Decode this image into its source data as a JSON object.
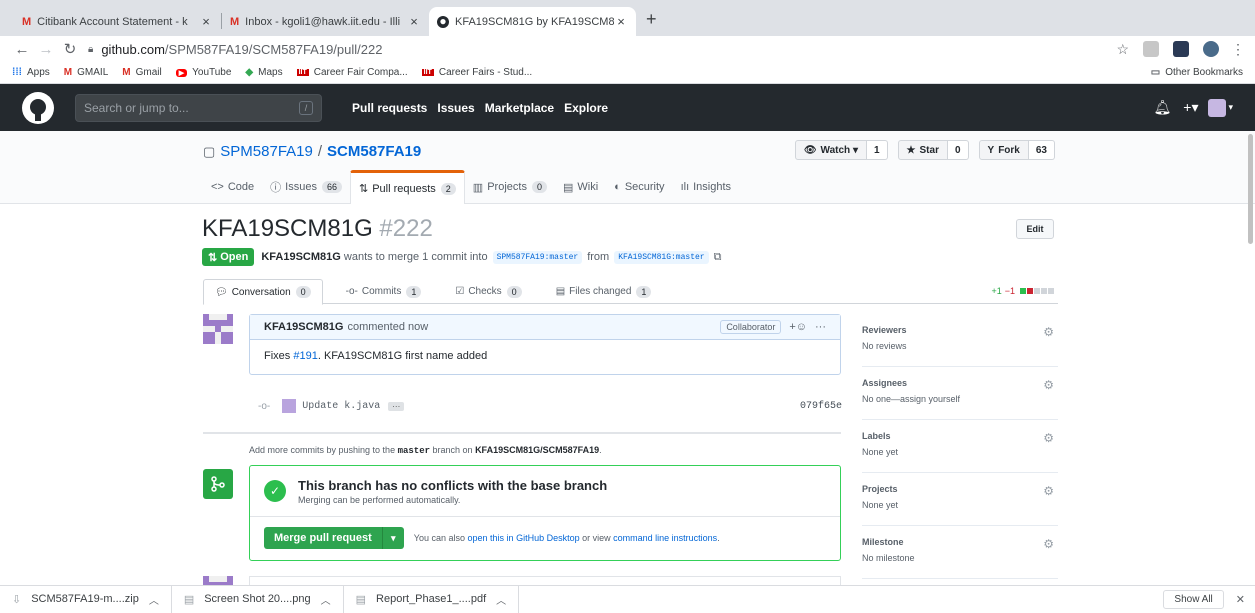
{
  "browser": {
    "tabs": [
      {
        "title": "Citibank Account Statement - k"
      },
      {
        "title": "Inbox - kgoli1@hawk.iit.edu - Illi"
      },
      {
        "title": "KFA19SCM81G by KFA19SCM81"
      }
    ],
    "url_host": "github.com",
    "url_path": "/SPM587FA19/SCM587FA19/pull/222",
    "bookmarks": [
      {
        "label": "Apps",
        "icon": "apps-grid-icon"
      },
      {
        "label": "GMAIL",
        "icon": "gmail-icon"
      },
      {
        "label": "Gmail",
        "icon": "gmail-icon"
      },
      {
        "label": "YouTube",
        "icon": "youtube-icon"
      },
      {
        "label": "Maps",
        "icon": "maps-icon"
      },
      {
        "label": "Career Fair Compa...",
        "icon": "iit-icon"
      },
      {
        "label": "Career Fairs - Stud...",
        "icon": "iit-icon"
      }
    ],
    "other_bookmarks": "Other Bookmarks"
  },
  "github": {
    "search_placeholder": "Search or jump to...",
    "search_key": "/",
    "nav": [
      "Pull requests",
      "Issues",
      "Marketplace",
      "Explore"
    ]
  },
  "repo": {
    "owner": "SPM587FA19",
    "sep": "/",
    "name": "SCM587FA19",
    "watch_label": "Watch",
    "watch_count": "1",
    "star_label": "Star",
    "star_count": "0",
    "fork_label": "Fork",
    "fork_count": "63",
    "tabs": [
      {
        "label": "Code",
        "count": ""
      },
      {
        "label": "Issues",
        "count": "66"
      },
      {
        "label": "Pull requests",
        "count": "2"
      },
      {
        "label": "Projects",
        "count": "0"
      },
      {
        "label": "Wiki",
        "count": ""
      },
      {
        "label": "Security",
        "count": ""
      },
      {
        "label": "Insights",
        "count": ""
      }
    ]
  },
  "pr": {
    "title": "KFA19SCM81G",
    "number": "#222",
    "edit_label": "Edit",
    "status": "Open",
    "author": "KFA19SCM81G",
    "meta_text": "wants to merge 1 commit into",
    "base_branch": "SPM587FA19:master",
    "from_text": "from",
    "head_branch": "KFA19SCM81G:master",
    "tabs": [
      {
        "label": "Conversation",
        "count": "0"
      },
      {
        "label": "Commits",
        "count": "1"
      },
      {
        "label": "Checks",
        "count": "0"
      },
      {
        "label": "Files changed",
        "count": "1"
      }
    ],
    "diff_plus": "+1",
    "diff_minus": "−1"
  },
  "comment": {
    "author": "KFA19SCM81G",
    "action": "commented now",
    "role": "Collaborator",
    "body_prefix": "Fixes",
    "issue_link": "#191",
    "body_rest": ". KFA19SCM81G first name added"
  },
  "commit": {
    "message": "Update k.java",
    "dots": "···",
    "sha": "079f65e"
  },
  "push_note": {
    "prefix": "Add more commits by pushing to the",
    "branch": "master",
    "mid": "branch on",
    "repo": "KFA19SCM81G/SCM587FA19",
    "end": "."
  },
  "merge": {
    "title": "This branch has no conflicts with the base branch",
    "subtitle": "Merging can be performed automatically.",
    "button": "Merge pull request",
    "also_text": "You can also",
    "desktop_link": "open this in GitHub Desktop",
    "or_text": "or view",
    "cli_link": "command line instructions",
    "end": "."
  },
  "sidebar": [
    {
      "heading": "Reviewers",
      "value": "No reviews"
    },
    {
      "heading": "Assignees",
      "value": "No one—assign yourself"
    },
    {
      "heading": "Labels",
      "value": "None yet"
    },
    {
      "heading": "Projects",
      "value": "None yet"
    },
    {
      "heading": "Milestone",
      "value": "No milestone"
    }
  ],
  "downloads": [
    {
      "name": "SCM587FA19-m....zip"
    },
    {
      "name": "Screen Shot 20....png"
    },
    {
      "name": "Report_Phase1_....pdf"
    }
  ],
  "show_all": "Show All",
  "colors": {
    "accent": "#0366d6",
    "success": "#28a745",
    "header": "#24292e",
    "tab_active": "#e36209"
  }
}
